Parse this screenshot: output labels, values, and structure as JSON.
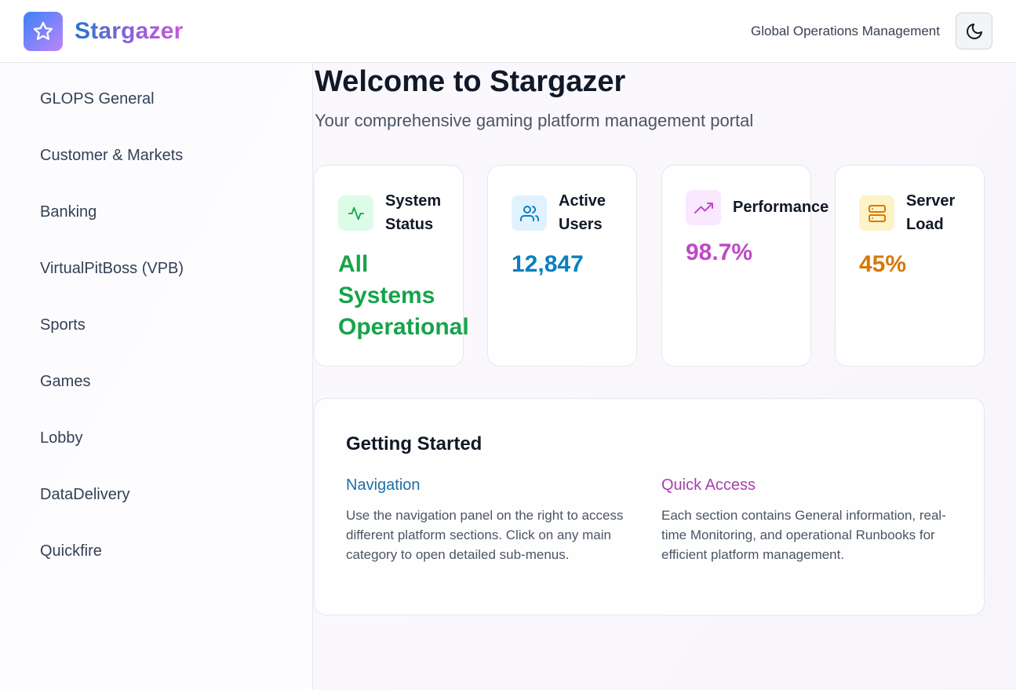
{
  "header": {
    "brand": "Stargazer",
    "subtitle": "Global Operations Management",
    "logo_icon": "star-icon",
    "theme_icon": "moon-icon"
  },
  "sidebar": {
    "items": [
      {
        "label": "GLOPS General"
      },
      {
        "label": "Customer & Markets"
      },
      {
        "label": "Banking"
      },
      {
        "label": "VirtualPitBoss (VPB)"
      },
      {
        "label": "Sports"
      },
      {
        "label": "Games"
      },
      {
        "label": "Lobby"
      },
      {
        "label": "DataDelivery"
      },
      {
        "label": "Quickfire"
      }
    ]
  },
  "main": {
    "title": "Welcome to Stargazer",
    "subtitle": "Your comprehensive gaming platform management portal",
    "cards": [
      {
        "label_line1": "System",
        "label_line2": "Status",
        "value_lines": [
          "All",
          "Systems",
          "Operational"
        ],
        "icon": "activity-icon",
        "color": "#16a34a"
      },
      {
        "label_line1": "Active",
        "label_line2": "Users",
        "value": "12,847",
        "icon": "users-icon",
        "color": "#0b7fc0"
      },
      {
        "label": "Performance",
        "value": "98.7%",
        "icon": "trending-up-icon",
        "color": "#c049c9"
      },
      {
        "label_line1": "Server",
        "label_line2": "Load",
        "value": "45%",
        "icon": "server-icon",
        "color": "#d97706"
      }
    ],
    "getting_started": {
      "title": "Getting Started",
      "navigation": {
        "heading": "Navigation",
        "text": "Use the navigation panel on the right to access different platform sections. Click on any main category to open detailed sub-menus."
      },
      "quick_access": {
        "heading": "Quick Access",
        "text": "Each section contains General information, real-time Monitoring, and operational Runbooks for efficient platform management."
      }
    }
  }
}
